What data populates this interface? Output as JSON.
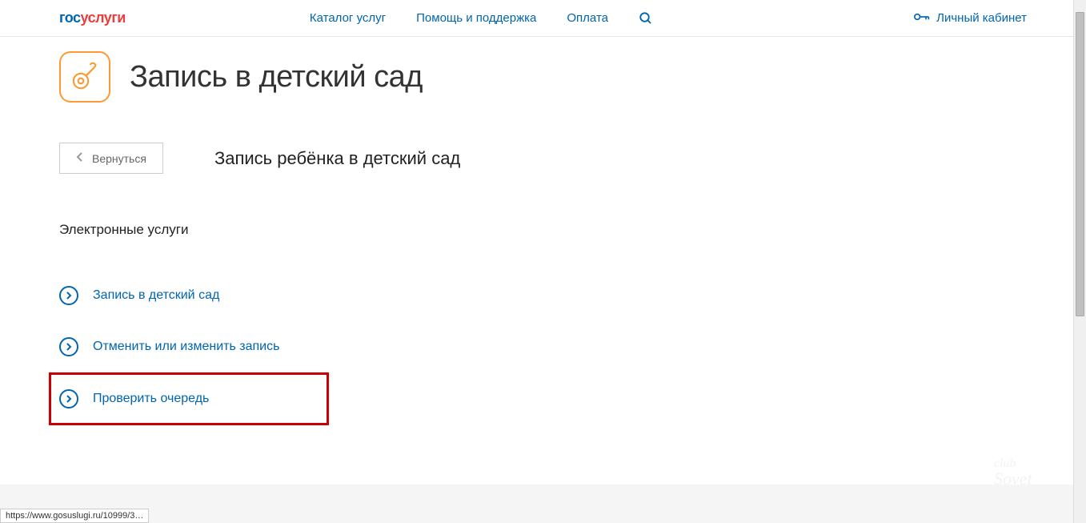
{
  "logo": {
    "part1": "гос",
    "part2": "услуги"
  },
  "nav": {
    "catalog": "Каталог услуг",
    "help": "Помощь и поддержка",
    "payment": "Оплата"
  },
  "account": {
    "label": "Личный кабинет"
  },
  "page": {
    "title": "Запись в детский сад",
    "back_label": "Вернуться",
    "subtitle": "Запись ребёнка в детский сад",
    "section": "Электронные услуги"
  },
  "services": [
    {
      "label": "Запись в детский сад"
    },
    {
      "label": "Отменить или изменить запись"
    },
    {
      "label": "Проверить очередь"
    }
  ],
  "status_url": "https://www.gosuslugi.ru/10999/3…"
}
